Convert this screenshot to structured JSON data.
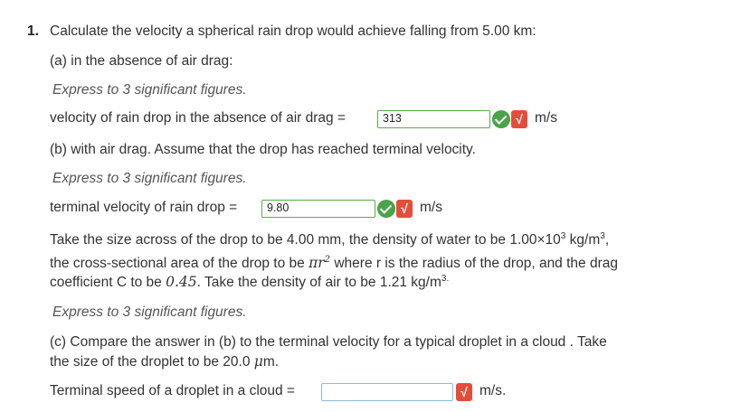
{
  "question": {
    "number": "1.",
    "prompt": "Calculate the velocity a spherical rain drop would achieve falling from 5.00 km:"
  },
  "part_a": {
    "label": "(a) in the absence of air drag:",
    "instruction": "Express to 3 significant figures.",
    "field_label": "velocity of rain drop in the absence of air drag =",
    "value": "313",
    "unit": "m/s"
  },
  "part_b": {
    "label": "(b) with air drag. Assume that the drop has reached terminal velocity.",
    "instruction": "Express to 3 significant figures.",
    "field_label": "terminal velocity of rain drop =",
    "value": "9.80",
    "unit": "m/s",
    "info_line1_prefix": "Take the size across of the drop to be 4.00 mm, the density of water to be 1.00×10",
    "info_line1_exp": "3",
    "info_line1_unit": " kg/m",
    "info_line1_unit_exp": "3",
    "info_line1_end": ",",
    "info_line2_prefix": "the cross-sectional area of the drop to be ",
    "info_line2_math": "πr",
    "info_line2_math_exp": "2",
    "info_line2_suffix": " where r is the radius of the drop, and the drag",
    "info_line3_prefix": "coefficient C to be ",
    "info_line3_math": "0.45",
    "info_line3_mid": ". Take the density of air to be 1.21 kg/m",
    "info_line3_exp": "3.",
    "instruction2": "Express to 3 significant figures."
  },
  "part_c": {
    "label_line1": "(c) Compare the answer in (b) to the terminal velocity for a typical droplet in a cloud . Take",
    "label_line2_prefix": "the size of the droplet to be 20.0 ",
    "label_line2_math": "μ",
    "label_line2_suffix": "m.",
    "field_label": "Terminal speed of a droplet in a cloud =",
    "value": "",
    "unit": "m/s."
  },
  "colors": {
    "correct_green": "#4aa44a",
    "sqrt_red": "#e44d3a",
    "empty_border": "#8fb9d6"
  },
  "icons": [
    "check-circle-icon",
    "sqrt-icon"
  ]
}
